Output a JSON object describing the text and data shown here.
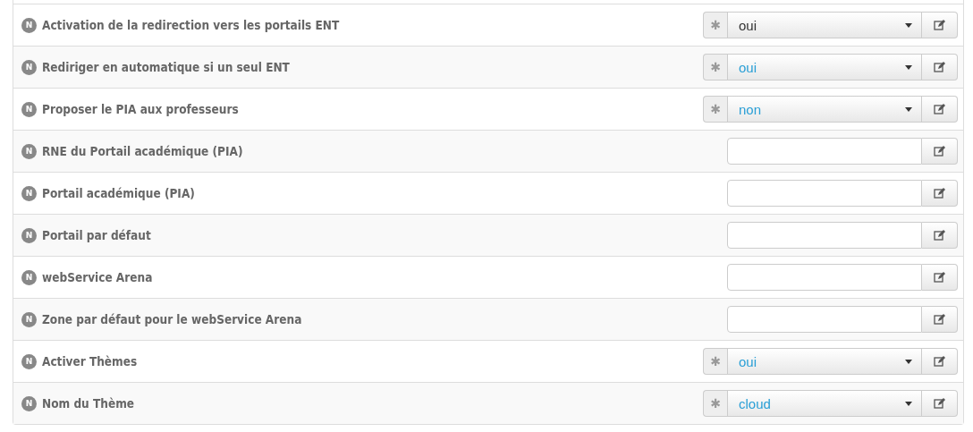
{
  "rows": [
    {
      "kind": "select",
      "badge": "N",
      "label": "Activation de la redirection vers les portails ENT",
      "required_mark": "✱",
      "value": "oui",
      "modified": false
    },
    {
      "kind": "select",
      "badge": "N",
      "label": "Rediriger en automatique si un seul ENT",
      "required_mark": "✱",
      "value": "oui",
      "modified": true
    },
    {
      "kind": "select",
      "badge": "N",
      "label": "Proposer le PIA aux professeurs",
      "required_mark": "✱",
      "value": "non",
      "modified": true
    },
    {
      "kind": "text",
      "badge": "N",
      "label": "RNE du Portail académique (PIA)"
    },
    {
      "kind": "text",
      "badge": "N",
      "label": "Portail académique (PIA)"
    },
    {
      "kind": "text",
      "badge": "N",
      "label": "Portail par défaut"
    },
    {
      "kind": "text",
      "badge": "N",
      "label": "webService Arena"
    },
    {
      "kind": "text",
      "badge": "N",
      "label": "Zone par défaut pour le webService Arena"
    },
    {
      "kind": "select",
      "badge": "N",
      "label": "Activer Thèmes",
      "required_mark": "✱",
      "value": "oui",
      "modified": true
    },
    {
      "kind": "select",
      "badge": "N",
      "label": "Nom du Thème",
      "required_mark": "✱",
      "value": "cloud",
      "modified": true
    }
  ]
}
